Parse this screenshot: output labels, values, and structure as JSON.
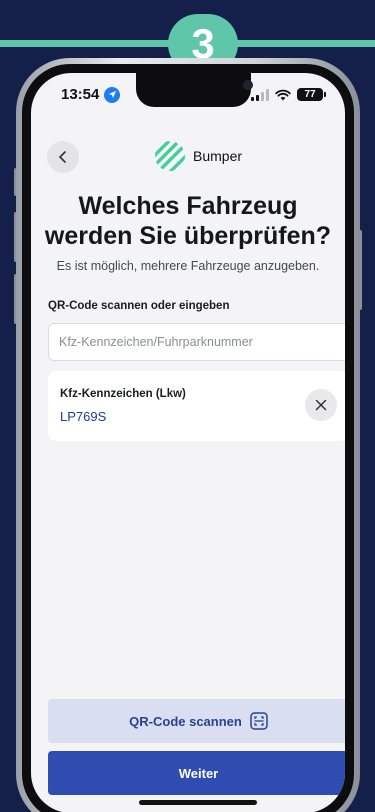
{
  "step_badge": "3",
  "status": {
    "time": "13:54",
    "battery": "77"
  },
  "header": {
    "brand_name": "Bumper"
  },
  "title_line1": "Welches Fahrzeug",
  "title_line2": "werden Sie überprüfen?",
  "subtitle": "Es ist möglich, mehrere Fahrzeuge anzugeben.",
  "section_label": "QR-Code scannen oder eingeben",
  "input": {
    "placeholder": "Kfz-Kennzeichen/Fuhrparknummer",
    "value": ""
  },
  "vehicle": {
    "label": "Kfz-Kennzeichen (Lkw)",
    "value": "LP769S"
  },
  "buttons": {
    "qr_scan": "QR-Code scannen",
    "next": "Weiter"
  },
  "colors": {
    "accent": "#5fc6a9",
    "primary": "#2f4db0",
    "background": "#14204a"
  }
}
